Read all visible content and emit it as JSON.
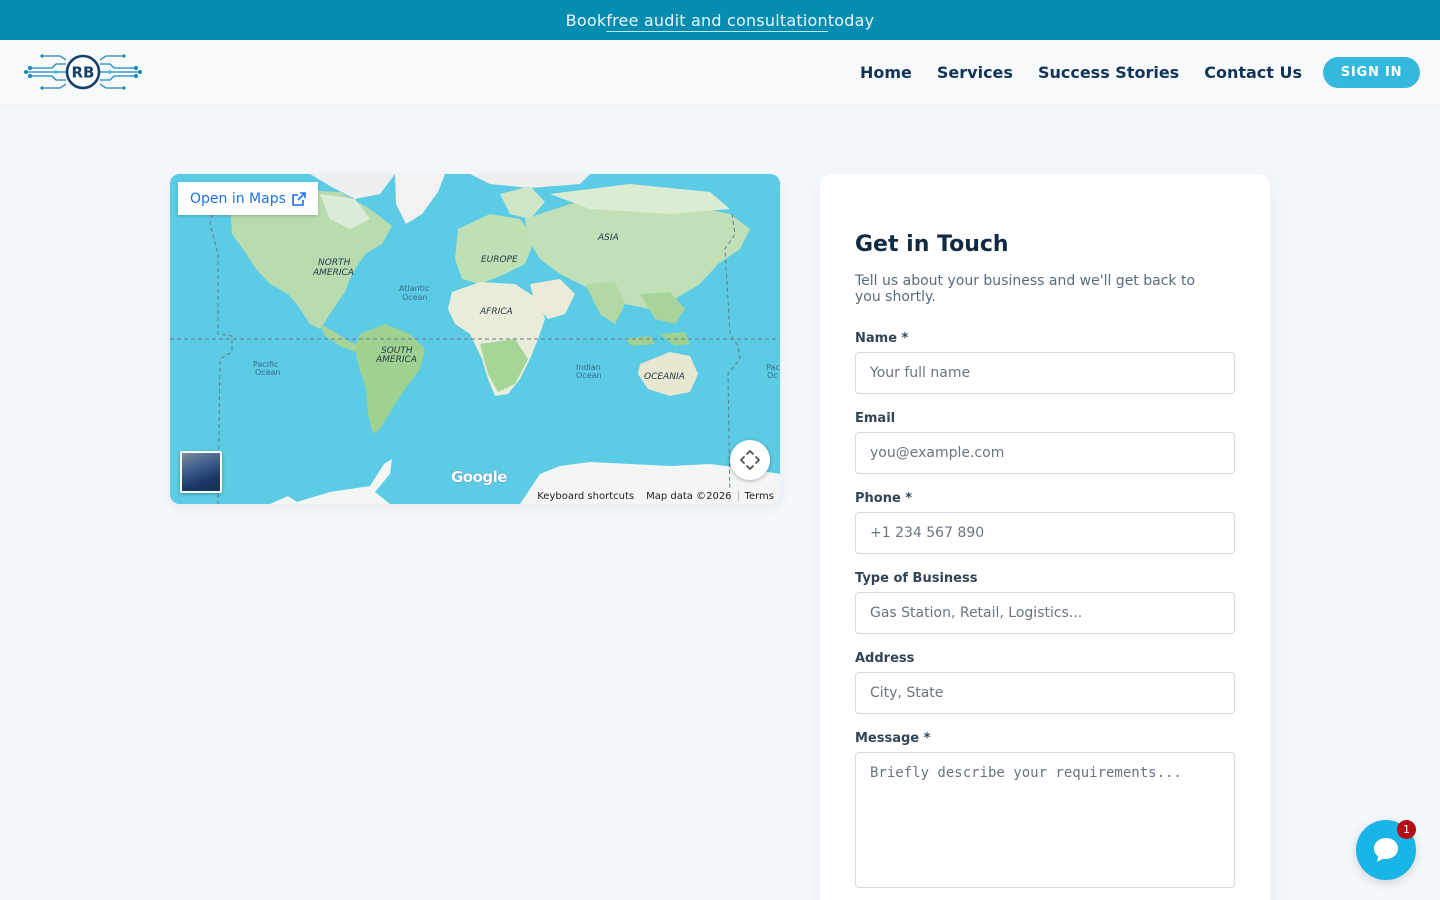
{
  "promo": {
    "prefix": "Book ",
    "link": "free audit and consultation",
    "suffix": " today"
  },
  "nav": {
    "logo_text": "RB",
    "links": [
      "Home",
      "Services",
      "Success Stories",
      "Contact Us"
    ],
    "signin": "SIGN IN"
  },
  "map": {
    "open_in_maps": "Open in Maps",
    "google": "Google",
    "keyboard_shortcuts": "Keyboard shortcuts",
    "map_data": "Map data ©2026",
    "terms": "Terms",
    "labels": {
      "north_america_1": "NORTH",
      "north_america_2": "AMERICA",
      "south_america_1": "SOUTH",
      "south_america_2": "AMERICA",
      "europe": "EUROPE",
      "asia": "ASIA",
      "africa": "AFRICA",
      "oceania": "OCEANIA",
      "atlantic_1": "Atlantic",
      "atlantic_2": "Ocean",
      "pacific_1": "Pacific",
      "pacific_2": "Ocean",
      "indian_1": "Indian",
      "indian_2": "Ocean",
      "pacific_right_1": "Pac",
      "pacific_right_2": "Oc"
    }
  },
  "form": {
    "title": "Get in Touch",
    "subtitle": "Tell us about your business and we'll get back to you shortly.",
    "name_label": "Name *",
    "name_placeholder": "Your full name",
    "email_label": "Email",
    "email_placeholder": "you@example.com",
    "phone_label": "Phone *",
    "phone_placeholder": "+1 234 567 890",
    "business_label": "Type of Business",
    "business_placeholder": "Gas Station, Retail, Logistics...",
    "address_label": "Address",
    "address_placeholder": "City, State",
    "message_label": "Message *",
    "message_placeholder": "Briefly describe your requirements..."
  },
  "chat": {
    "badge": "1"
  },
  "colors": {
    "primary": "#058cb1",
    "accent": "#34b8de",
    "navy": "#12345a",
    "chat": "#18b5e6",
    "badge": "#b30d16"
  }
}
